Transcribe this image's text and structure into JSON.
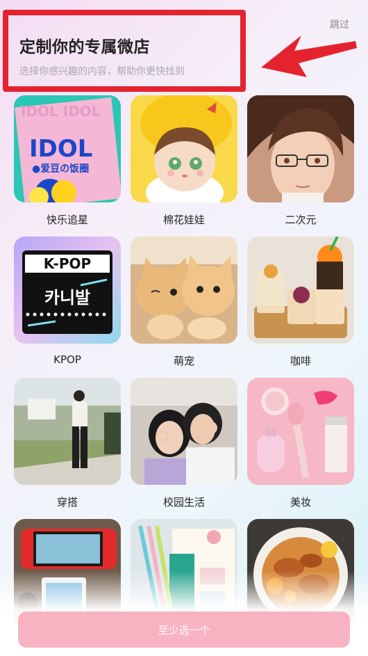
{
  "header": {
    "title": "定制你的专属微店",
    "subtitle": "选择你感兴趣的内容，帮助你更快找到",
    "skip_label": "跳过"
  },
  "categories": [
    {
      "label": "快乐追星",
      "image": "idol-poster"
    },
    {
      "label": "棉花娃娃",
      "image": "cotton-doll"
    },
    {
      "label": "二次元",
      "image": "anime-portrait"
    },
    {
      "label": "KPOP",
      "image": "kpop-poster"
    },
    {
      "label": "萌宠",
      "image": "kittens"
    },
    {
      "label": "咖啡",
      "image": "coffee-drinks"
    },
    {
      "label": "穿搭",
      "image": "outfit-photo"
    },
    {
      "label": "校园生活",
      "image": "campus-friends"
    },
    {
      "label": "美妆",
      "image": "cosmetics"
    },
    {
      "label": "",
      "image": "game-console"
    },
    {
      "label": "",
      "image": "stationery-journal"
    },
    {
      "label": "",
      "image": "food-plate"
    }
  ],
  "idol_poster": {
    "text_top": "IDOL IDOL",
    "text_main": "IDOL",
    "text_sub": "●爱豆の饭圈"
  },
  "kpop_poster": {
    "text_main": "K-POP",
    "text_sub": "카니발"
  },
  "cta": {
    "label": "至少选一个"
  },
  "colors": {
    "accent": "#e5232e",
    "cta_bg": "#f8b3c2"
  }
}
